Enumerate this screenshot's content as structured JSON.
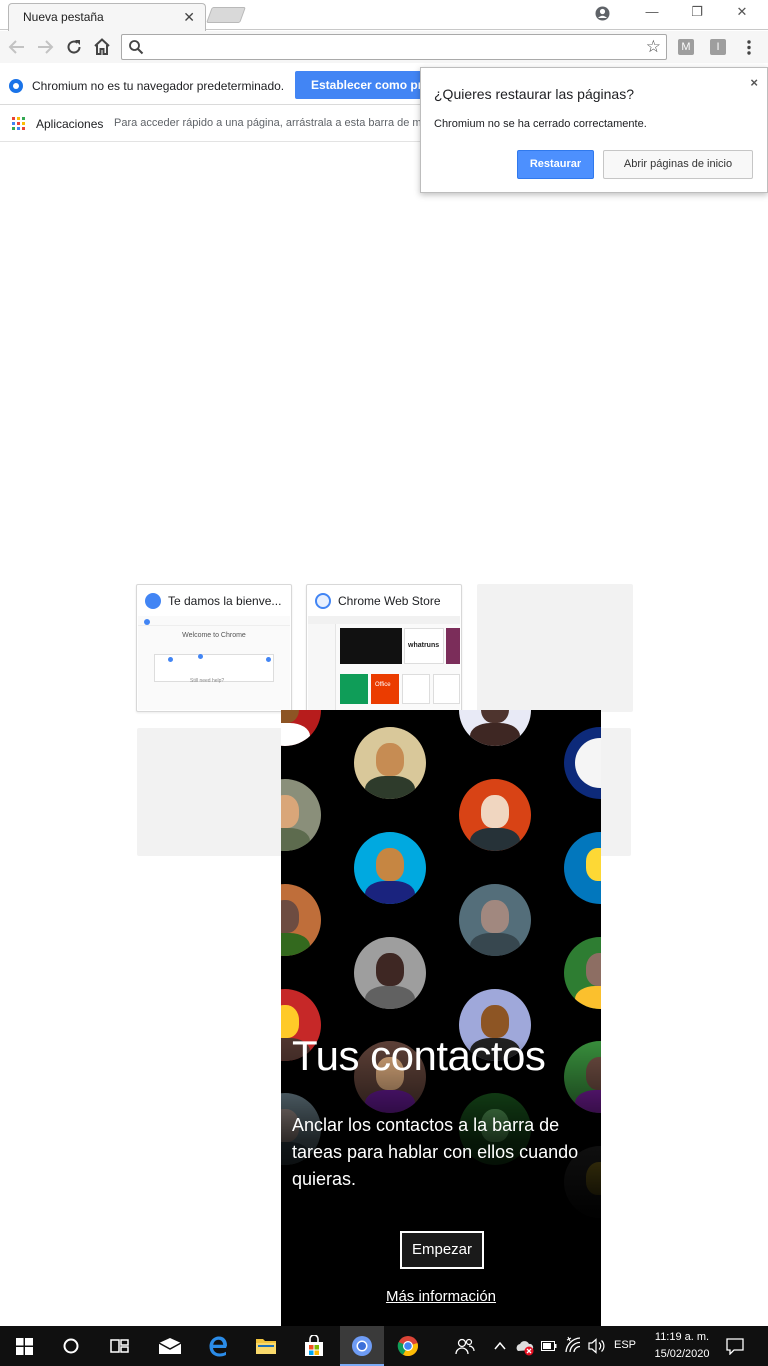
{
  "browser": {
    "tab": {
      "title": "Nueva pestaña",
      "close": "✕"
    },
    "window_controls": {
      "minimize": "—",
      "restore": "❐",
      "close": "✕"
    },
    "toolbar": {
      "extensions": [
        "M",
        "I"
      ]
    },
    "infobar": {
      "message": "Chromium no es tu navegador predeterminado.",
      "button": "Establecer como predeterminado"
    },
    "bookmarks": {
      "apps_label": "Aplicaciones",
      "hint": "Para acceder rápido a una página, arrástrala a esta barra de marcadores."
    },
    "restore_popup": {
      "title": "¿Quieres restaurar las páginas?",
      "description": "Chromium no se ha cerrado correctamente.",
      "restore_button": "Restaurar",
      "open_home_button": "Abrir páginas de inicio",
      "close": "×"
    },
    "tiles": [
      {
        "title": "Te damos la bienve...",
        "thumb_heading": "Welcome to Chrome",
        "thumb_footer": "Still need help?"
      },
      {
        "title": "Chrome Web Store",
        "thumb_label": "whatruns",
        "thumb_label_2": "Office"
      },
      {
        "title": ""
      },
      {
        "title": ""
      }
    ]
  },
  "people_panel": {
    "title": "Tus contactos",
    "description": "Anclar los contactos a la barra de tareas para hablar con ellos cuando quieras.",
    "start_button": "Empezar",
    "more_info_link": "Más información"
  },
  "taskbar": {
    "language": "ESP",
    "time": "11:19 a. m.",
    "date": "15/02/2020"
  },
  "colors": {
    "accent_blue": "#4285f4",
    "taskbar": "#101010",
    "people_bg": "#000000"
  }
}
